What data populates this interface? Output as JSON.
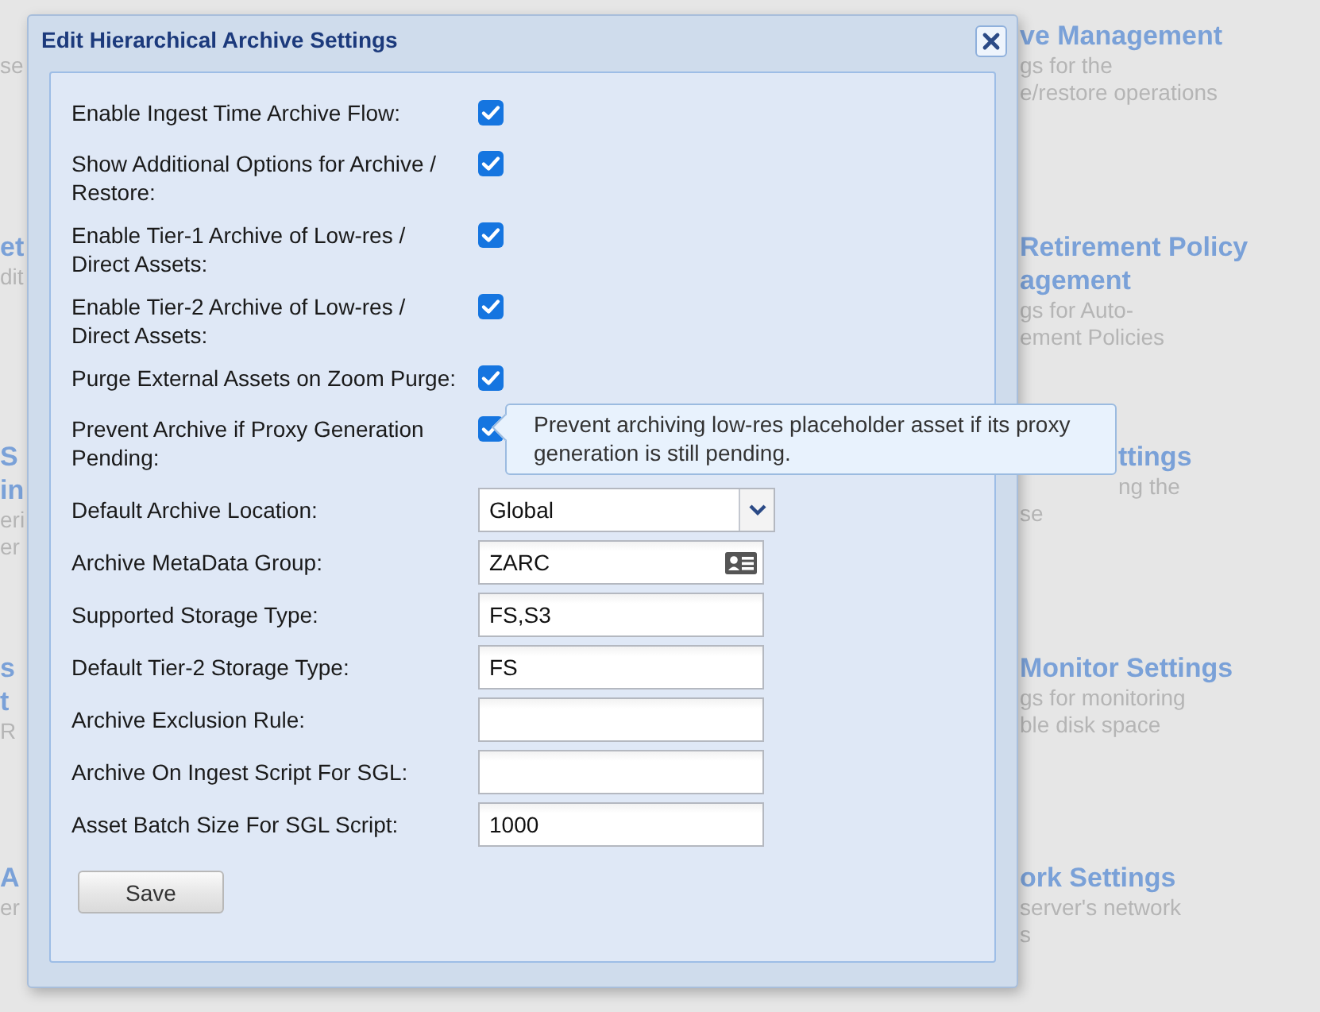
{
  "background": {
    "left_tiles": [
      {
        "lines": [
          {
            "kind": "desc",
            "text": "se"
          }
        ]
      },
      {
        "lines": [
          {
            "kind": "title",
            "text": "et"
          },
          {
            "kind": "desc",
            "text": "dit"
          }
        ]
      },
      {
        "lines": [
          {
            "kind": "title",
            "text": "S"
          },
          {
            "kind": "title",
            "text": "in"
          },
          {
            "kind": "desc",
            "text": "eri"
          },
          {
            "kind": "desc",
            "text": "er"
          }
        ]
      },
      {
        "lines": [
          {
            "kind": "title",
            "text": "s"
          },
          {
            "kind": "title",
            "text": "t"
          },
          {
            "kind": "desc",
            "text": "R"
          }
        ]
      },
      {
        "lines": [
          {
            "kind": "title",
            "text": "A"
          },
          {
            "kind": "desc",
            "text": "er"
          }
        ]
      }
    ],
    "right_tiles": [
      {
        "lines": [
          {
            "kind": "title",
            "text": "ve Management"
          },
          {
            "kind": "desc",
            "text": "gs for the"
          },
          {
            "kind": "desc",
            "text": "e/restore operations"
          }
        ]
      },
      {
        "lines": [
          {
            "kind": "title",
            "text": "Retirement Policy"
          },
          {
            "kind": "title",
            "text": "agement"
          },
          {
            "kind": "desc",
            "text": "gs for Auto-"
          },
          {
            "kind": "desc",
            "text": "ement Policies"
          }
        ]
      },
      {
        "lines": [
          {
            "kind": "title",
            "text": "ttings"
          },
          {
            "kind": "desc",
            "text": "ng the"
          },
          {
            "kind": "desc",
            "text": "se"
          }
        ]
      },
      {
        "lines": [
          {
            "kind": "title",
            "text": "Monitor Settings"
          },
          {
            "kind": "desc",
            "text": "gs for monitoring"
          },
          {
            "kind": "desc",
            "text": "ble disk space"
          }
        ]
      },
      {
        "lines": [
          {
            "kind": "title",
            "text": "ork Settings"
          },
          {
            "kind": "desc",
            "text": "server's network"
          },
          {
            "kind": "desc",
            "text": "s"
          }
        ]
      }
    ]
  },
  "dialog": {
    "title": "Edit Hierarchical Archive Settings",
    "fields": [
      {
        "kind": "checkbox",
        "label": "Enable Ingest Time Archive Flow:",
        "checked": true
      },
      {
        "kind": "checkbox",
        "label": "Show Additional Options for Archive / Restore:",
        "checked": true
      },
      {
        "kind": "checkbox",
        "label": "Enable Tier-1 Archive of Low-res / Direct Assets:",
        "checked": true
      },
      {
        "kind": "checkbox",
        "label": "Enable Tier-2 Archive of Low-res / Direct Assets:",
        "checked": true
      },
      {
        "kind": "checkbox",
        "label": "Purge External Assets on Zoom Purge:",
        "checked": true
      },
      {
        "kind": "checkbox",
        "label": "Prevent Archive if Proxy Generation Pending:",
        "checked": true,
        "tooltip": "Prevent archiving low-res placeholder asset if its proxy generation is still pending."
      },
      {
        "kind": "select",
        "label": "Default Archive Location:",
        "value": "Global"
      },
      {
        "kind": "lookup",
        "label": "Archive MetaData Group:",
        "value": "ZARC"
      },
      {
        "kind": "text",
        "label": "Supported Storage Type:",
        "value": "FS,S3"
      },
      {
        "kind": "text",
        "label": "Default Tier-2 Storage Type:",
        "value": "FS"
      },
      {
        "kind": "text",
        "label": "Archive Exclusion Rule:"
      },
      {
        "kind": "text",
        "label": "Archive On Ingest Script For SGL:"
      },
      {
        "kind": "text",
        "label": "Asset Batch Size For SGL Script:",
        "value": "1000"
      }
    ],
    "save_button": "Save"
  }
}
